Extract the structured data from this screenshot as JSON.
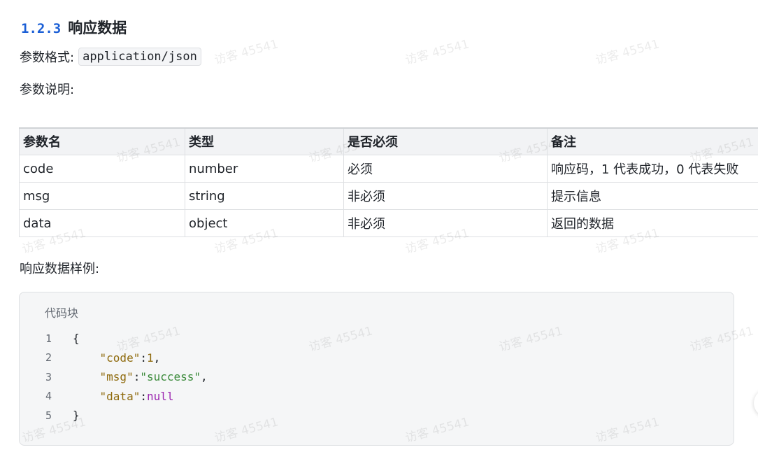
{
  "section": {
    "number": "1.2.3",
    "title": "响应数据"
  },
  "format_line": {
    "label": "参数格式:",
    "value": "application/json"
  },
  "desc_label": "参数说明:",
  "params_table": {
    "headers": [
      "参数名",
      "类型",
      "是否必须",
      "备注"
    ],
    "rows": [
      [
        "code",
        "number",
        "必须",
        "响应码，1 代表成功，0 代表失败"
      ],
      [
        "msg",
        "string",
        "非必须",
        "提示信息"
      ],
      [
        "data",
        "object",
        "非必须",
        "返回的数据"
      ]
    ]
  },
  "sample_label": "响应数据样例:",
  "code_block": {
    "label": "代码块",
    "line_numbers": [
      "1",
      "2",
      "3",
      "4",
      "5"
    ],
    "lines": [
      {
        "indent": "",
        "tokens": [
          {
            "t": "plain",
            "v": "{"
          }
        ]
      },
      {
        "indent": "    ",
        "tokens": [
          {
            "t": "key",
            "v": "\"code\""
          },
          {
            "t": "plain",
            "v": ":"
          },
          {
            "t": "num",
            "v": "1"
          },
          {
            "t": "plain",
            "v": ","
          }
        ]
      },
      {
        "indent": "    ",
        "tokens": [
          {
            "t": "key",
            "v": "\"msg\""
          },
          {
            "t": "plain",
            "v": ":"
          },
          {
            "t": "str",
            "v": "\"success\""
          },
          {
            "t": "plain",
            "v": ","
          }
        ]
      },
      {
        "indent": "    ",
        "tokens": [
          {
            "t": "key",
            "v": "\"data\""
          },
          {
            "t": "plain",
            "v": ":"
          },
          {
            "t": "null",
            "v": "null"
          }
        ]
      },
      {
        "indent": "",
        "tokens": [
          {
            "t": "plain",
            "v": "}"
          }
        ]
      }
    ]
  },
  "watermark_text": "访客 45541",
  "colors": {
    "section_number": "#1b5fd6",
    "key": "#8f6b0e",
    "string": "#3a8a3a",
    "null": "#9c27b0"
  }
}
